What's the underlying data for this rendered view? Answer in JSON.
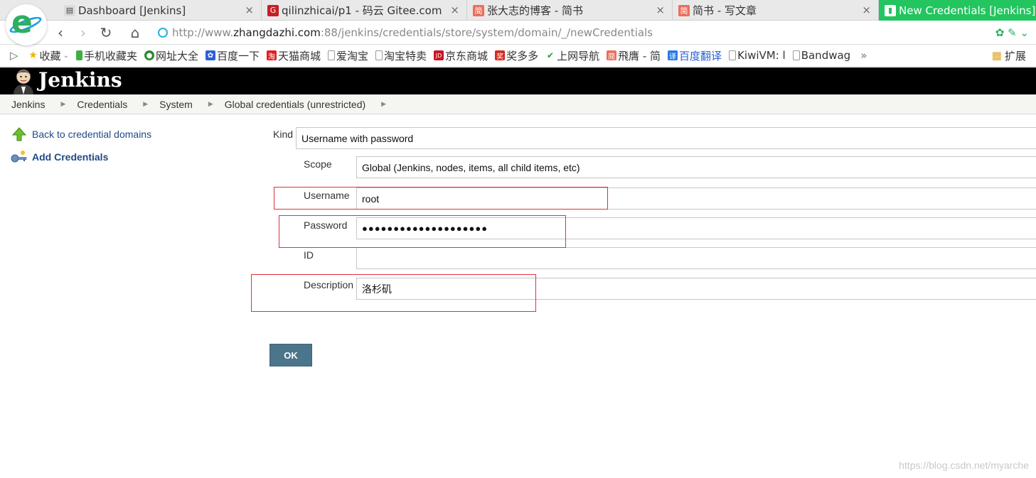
{
  "browser": {
    "tabs": [
      {
        "title": "Dashboard [Jenkins]",
        "active": false
      },
      {
        "title": "qilinzhicai/p1 - 码云 Gitee.com",
        "active": false
      },
      {
        "title": "张大志的博客 - 简书",
        "active": false
      },
      {
        "title": "简书 - 写文章",
        "active": false
      },
      {
        "title": "New Credentials [Jenkins]",
        "active": true
      }
    ],
    "tab_close_glyph": "×",
    "url_prefix": "http://www.",
    "url_host": "zhangdazhi.com",
    "url_rest": ":88/jenkins/credentials/store/system/domain/_/newCredentials",
    "bookmarks": [
      {
        "label": "收藏",
        "icon": "star-icon"
      },
      {
        "label": "手机收藏夹",
        "icon": "phone-icon"
      },
      {
        "label": "网址大全",
        "icon": "globe-icon"
      },
      {
        "label": "百度一下",
        "icon": "baidu-icon"
      },
      {
        "label": "天猫商城",
        "icon": "tmall-icon"
      },
      {
        "label": "爱淘宝",
        "icon": "page-icon"
      },
      {
        "label": "淘宝特卖",
        "icon": "page-icon"
      },
      {
        "label": "京东商城",
        "icon": "jd-icon"
      },
      {
        "label": "奖多多",
        "icon": "jiang-icon"
      },
      {
        "label": "上网导航",
        "icon": "hao-icon"
      },
      {
        "label": "飛膺 - 简",
        "icon": "jian-icon"
      },
      {
        "label": "百度翻译",
        "icon": "translate-icon"
      },
      {
        "label": "KiwiVM: l",
        "icon": "page-icon"
      },
      {
        "label": "Bandwag",
        "icon": "page-icon"
      }
    ],
    "bookmarks_more": "»",
    "extensions_label": "扩展"
  },
  "jenkins": {
    "brand": "Jenkins",
    "breadcrumbs": [
      "Jenkins",
      "Credentials",
      "System",
      "Global credentials (unrestricted)"
    ],
    "sidebar": [
      {
        "label": "Back to credential domains",
        "icon": "up-arrow-icon"
      },
      {
        "label": "Add Credentials",
        "icon": "key-icon"
      }
    ],
    "form": {
      "kind_label": "Kind",
      "kind_value": "Username with password",
      "scope_label": "Scope",
      "scope_value": "Global (Jenkins, nodes, items, all child items, etc)",
      "username_label": "Username",
      "username_value": "root",
      "password_label": "Password",
      "password_value": "●●●●●●●●●●●●●●●●●●●●",
      "id_label": "ID",
      "id_value": "",
      "description_label": "Description",
      "description_value": "洛杉矶",
      "ok_label": "OK"
    }
  },
  "watermark": "https://blog.csdn.net/myarche",
  "colors": {
    "active_tab": "#22c55e",
    "jenkins_header": "#000000",
    "link": "#204a87",
    "ok_button": "#4b758b",
    "highlight_box": "#e0303a"
  }
}
